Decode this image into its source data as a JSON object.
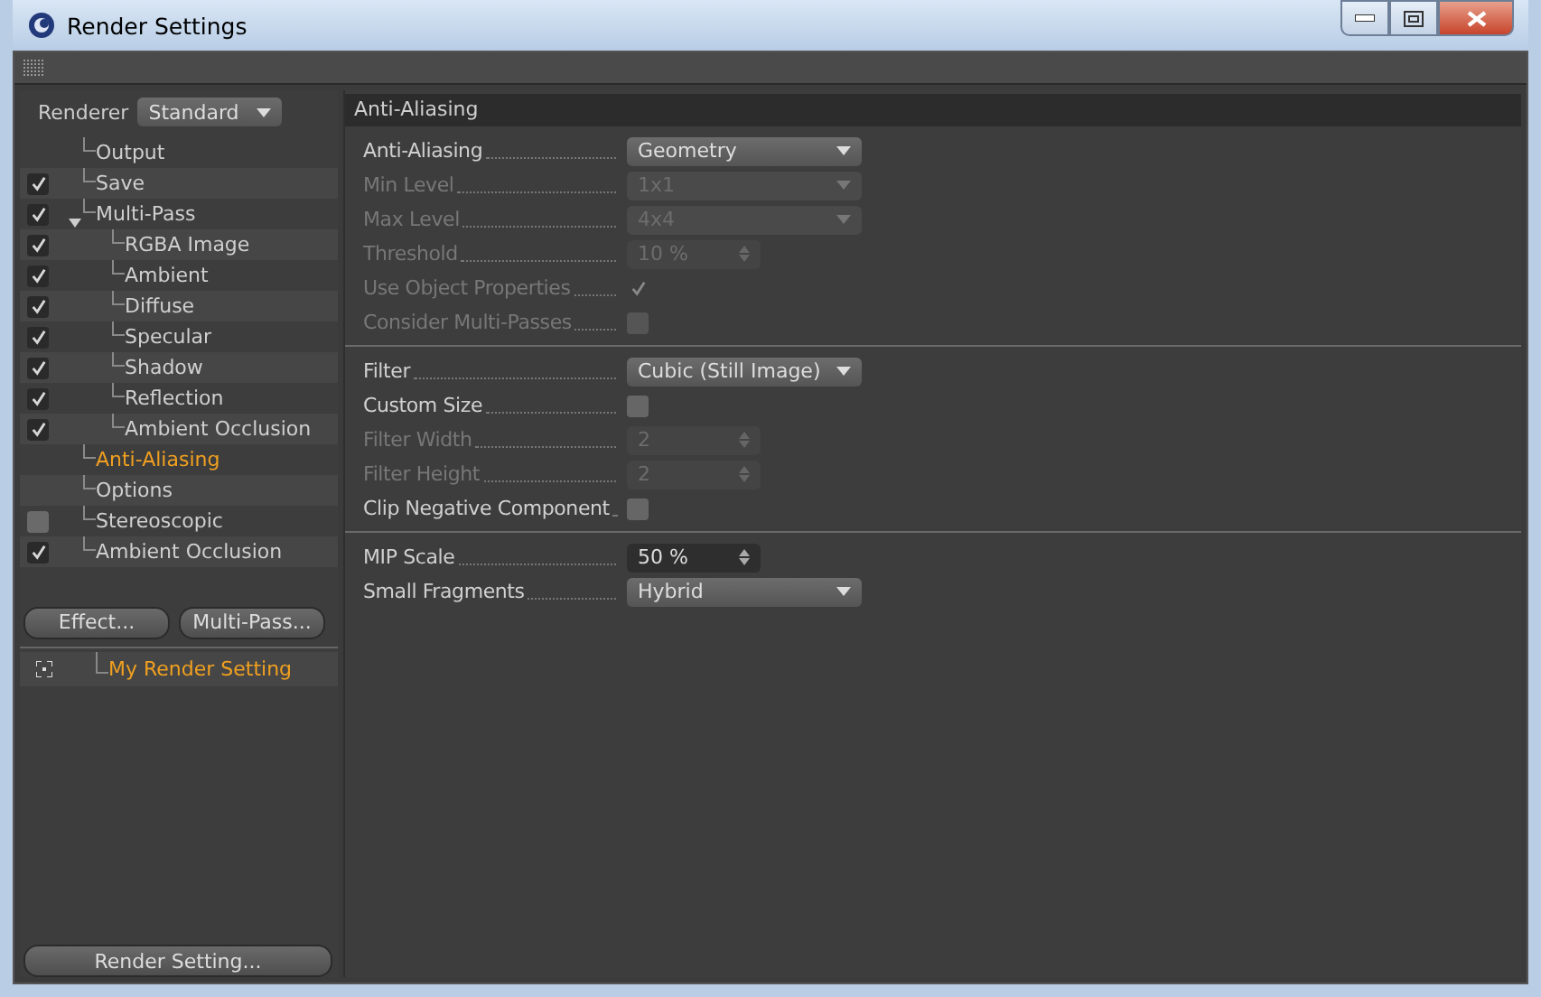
{
  "window": {
    "title": "Render Settings"
  },
  "renderer": {
    "label": "Renderer",
    "value": "Standard"
  },
  "tree": [
    {
      "label": "Output",
      "kind": "plain",
      "selected": false
    },
    {
      "label": "Save",
      "kind": "checkbox",
      "checked": true,
      "selected": false
    },
    {
      "label": "Multi-Pass",
      "kind": "checkbox",
      "checked": true,
      "selected": false,
      "expanded": true,
      "children": [
        {
          "label": "RGBA Image",
          "kind": "checkbox",
          "checked": true,
          "selected": false
        },
        {
          "label": "Ambient",
          "kind": "checkbox",
          "checked": true,
          "selected": false
        },
        {
          "label": "Diffuse",
          "kind": "checkbox",
          "checked": true,
          "selected": false
        },
        {
          "label": "Specular",
          "kind": "checkbox",
          "checked": true,
          "selected": false
        },
        {
          "label": "Shadow",
          "kind": "checkbox",
          "checked": true,
          "selected": false
        },
        {
          "label": "Reflection",
          "kind": "checkbox",
          "checked": true,
          "selected": false
        },
        {
          "label": "Ambient Occlusion",
          "kind": "checkbox",
          "checked": true,
          "selected": false
        }
      ]
    },
    {
      "label": "Anti-Aliasing",
      "kind": "plain",
      "selected": true
    },
    {
      "label": "Options",
      "kind": "plain",
      "selected": false
    },
    {
      "label": "Stereoscopic",
      "kind": "checkbox",
      "checked": false,
      "selected": false
    },
    {
      "label": "Ambient Occlusion",
      "kind": "checkbox",
      "checked": true,
      "selected": false
    }
  ],
  "buttons": [
    "Effect...",
    "Multi-Pass..."
  ],
  "settings_list": [
    {
      "label": "My Render Setting",
      "selected": true
    }
  ],
  "bottom_button": "Render Setting...",
  "panel": {
    "title": "Anti-Aliasing",
    "sections": [
      [
        {
          "label": "Anti-Aliasing",
          "kind": "dropdown",
          "value": "Geometry",
          "disabled": false
        },
        {
          "label": "Min Level",
          "kind": "dropdown",
          "value": "1x1",
          "disabled": true
        },
        {
          "label": "Max Level",
          "kind": "dropdown",
          "value": "4x4",
          "disabled": true
        },
        {
          "label": "Threshold",
          "kind": "number",
          "value": "10 %",
          "disabled": true
        },
        {
          "label": "Use Object Properties",
          "kind": "checkbox",
          "checked": true,
          "disabled": true
        },
        {
          "label": "Consider Multi-Passes",
          "kind": "checkbox",
          "checked": false,
          "disabled": true
        }
      ],
      [
        {
          "label": "Filter",
          "kind": "dropdown",
          "value": "Cubic (Still Image)",
          "disabled": false
        },
        {
          "label": "Custom Size",
          "kind": "checkbox",
          "checked": false,
          "disabled": false
        },
        {
          "label": "Filter Width",
          "kind": "number",
          "value": "2",
          "disabled": true
        },
        {
          "label": "Filter Height",
          "kind": "number",
          "value": "2",
          "disabled": true
        },
        {
          "label": "Clip Negative Component",
          "kind": "checkbox",
          "checked": false,
          "disabled": false
        }
      ],
      [
        {
          "label": "MIP Scale",
          "kind": "number",
          "value": "50 %",
          "disabled": false
        },
        {
          "label": "Small Fragments",
          "kind": "dropdown",
          "value": "Hybrid",
          "disabled": false
        }
      ]
    ]
  }
}
